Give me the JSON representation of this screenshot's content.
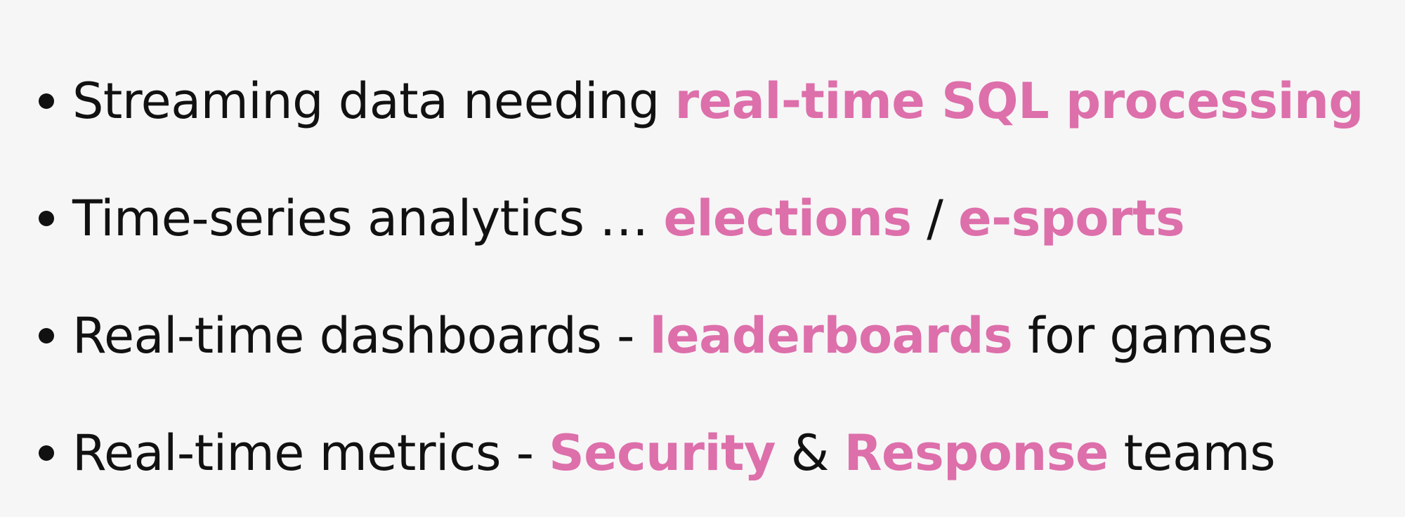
{
  "colors": {
    "background": "#f6f6f6",
    "text": "#111111",
    "highlight": "#dd6fab"
  },
  "bullets": [
    {
      "segments": [
        {
          "text": "Streaming data needing ",
          "highlight": false
        },
        {
          "text": "real-time SQL processing",
          "highlight": true
        }
      ]
    },
    {
      "segments": [
        {
          "text": "Time-series analytics … ",
          "highlight": false
        },
        {
          "text": "elections",
          "highlight": true
        },
        {
          "text": " / ",
          "highlight": false
        },
        {
          "text": "e-sports",
          "highlight": true
        }
      ]
    },
    {
      "segments": [
        {
          "text": "Real-time dashboards - ",
          "highlight": false
        },
        {
          "text": "leaderboards",
          "highlight": true
        },
        {
          "text": " for games",
          "highlight": false
        }
      ]
    },
    {
      "segments": [
        {
          "text": "Real-time metrics - ",
          "highlight": false
        },
        {
          "text": "Security",
          "highlight": true
        },
        {
          "text": " & ",
          "highlight": false
        },
        {
          "text": "Response",
          "highlight": true
        },
        {
          "text": " teams",
          "highlight": false
        }
      ]
    }
  ]
}
